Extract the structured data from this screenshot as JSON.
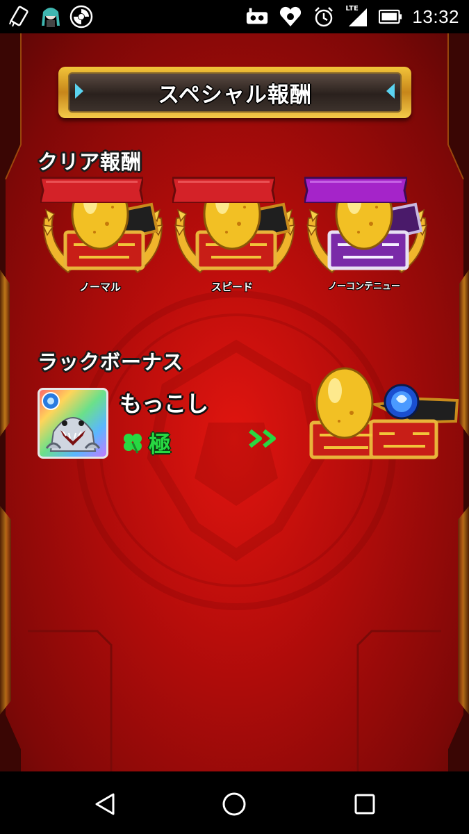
{
  "status_bar": {
    "time": "13:32",
    "network_label": "LTE",
    "left_icons": [
      "rotate-icon",
      "avatar-icon",
      "app-icon"
    ],
    "right_icons": [
      "vr-icon",
      "heart-app-icon",
      "alarm-icon",
      "signal-icon",
      "battery-icon"
    ]
  },
  "title": "スペシャル報酬",
  "clear_rewards": {
    "heading": "クリア報酬",
    "items": [
      {
        "label": "ノーマル",
        "ribbon_color": "#d42228"
      },
      {
        "label": "スピード",
        "ribbon_color": "#d42228"
      },
      {
        "label": "ノーコンテニュー",
        "ribbon_color": "#a524c9"
      }
    ]
  },
  "luck_bonus": {
    "heading": "ラックボーナス",
    "monster_name": "もっこし",
    "luck_label": "極",
    "clover_icon": "clover-icon",
    "arrow_icon": "double-chevron-right-icon"
  },
  "nav_bar": {
    "buttons": [
      "back-icon",
      "home-icon",
      "recents-icon"
    ]
  },
  "colors": {
    "background": "#c00e0c",
    "gold": "#f2c43a",
    "luck_green": "#28d842"
  }
}
